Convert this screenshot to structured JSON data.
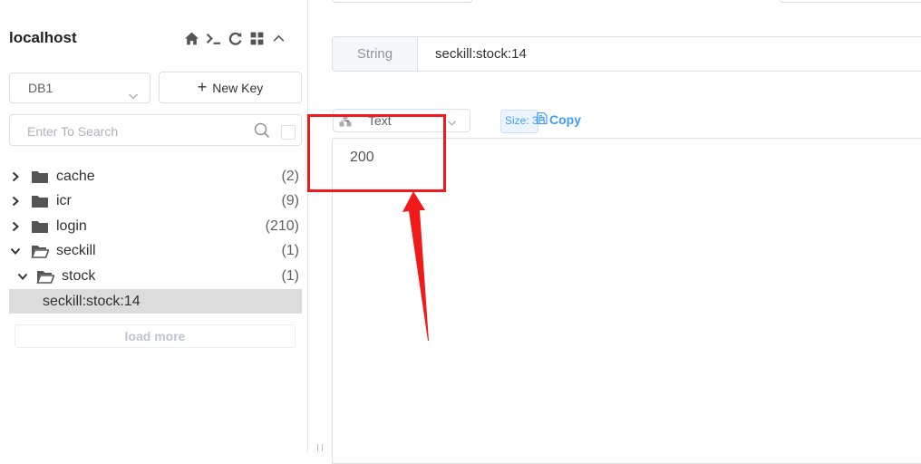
{
  "sidebar": {
    "connection_name": "localhost",
    "tools": [
      "home-icon",
      "terminal-icon",
      "refresh-icon",
      "grid-icon",
      "chevron-up-icon"
    ],
    "db_select": {
      "value": "DB1"
    },
    "new_key_label": "New Key",
    "search": {
      "placeholder": "Enter To Search"
    },
    "tree": {
      "folders": [
        {
          "label": "cache",
          "count": "(2)",
          "expanded": false
        },
        {
          "label": "icr",
          "count": "(9)",
          "expanded": false
        },
        {
          "label": "login",
          "count": "(210)",
          "expanded": false
        },
        {
          "label": "seckill",
          "count": "(1)",
          "expanded": true
        }
      ],
      "subfolder": {
        "label": "stock",
        "count": "(1)",
        "expanded": true
      },
      "selected_key": "seckill:stock:14"
    },
    "load_more_label": "load more"
  },
  "main": {
    "key_type": "String",
    "key_name": "seckill:stock:14",
    "view_format": "Text",
    "size_label": "Size: 3B",
    "copy_label": "Copy",
    "value": "200"
  },
  "annotation": {
    "color": "#f11a1a"
  },
  "colors": {
    "accent": "#409eff",
    "selected_row": "#dcdcdc",
    "border": "#dcdfe6"
  }
}
